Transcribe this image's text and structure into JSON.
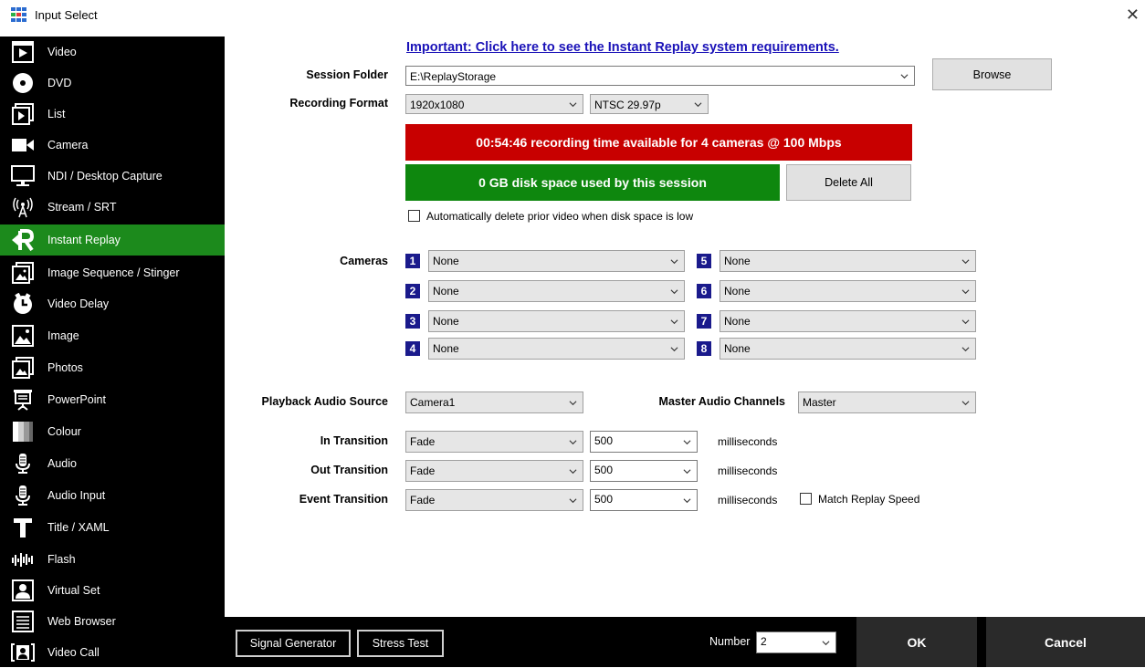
{
  "window": {
    "title": "Input Select"
  },
  "sidebar": {
    "items": [
      {
        "label": "Video",
        "icon": "video-icon"
      },
      {
        "label": "DVD",
        "icon": "dvd-icon"
      },
      {
        "label": "List",
        "icon": "list-icon"
      },
      {
        "label": "Camera",
        "icon": "camera-icon"
      },
      {
        "label": "NDI / Desktop Capture",
        "icon": "monitor-icon"
      },
      {
        "label": "Stream / SRT",
        "icon": "antenna-icon"
      },
      {
        "label": "Instant Replay",
        "icon": "replay-icon"
      },
      {
        "label": "Image Sequence / Stinger",
        "icon": "image-sequence-icon"
      },
      {
        "label": "Video Delay",
        "icon": "timer-icon"
      },
      {
        "label": "Image",
        "icon": "image-icon"
      },
      {
        "label": "Photos",
        "icon": "photos-icon"
      },
      {
        "label": "PowerPoint",
        "icon": "presentation-icon"
      },
      {
        "label": "Colour",
        "icon": "colour-icon"
      },
      {
        "label": "Audio",
        "icon": "microphone-icon"
      },
      {
        "label": "Audio Input",
        "icon": "microphone-icon"
      },
      {
        "label": "Title / XAML",
        "icon": "title-icon"
      },
      {
        "label": "Flash",
        "icon": "flash-icon"
      },
      {
        "label": "Virtual Set",
        "icon": "virtual-set-icon"
      },
      {
        "label": "Web Browser",
        "icon": "web-browser-icon"
      },
      {
        "label": "Video Call",
        "icon": "video-call-icon"
      }
    ]
  },
  "main": {
    "requirements_link": "Important: Click here to see the Instant Replay system requirements.",
    "session_folder": {
      "label": "Session Folder",
      "value": "E:\\ReplayStorage"
    },
    "browse_label": "Browse",
    "recording_format": {
      "label": "Recording Format",
      "resolution": "1920x1080",
      "framerate": "NTSC 29.97p"
    },
    "recording_banner": "00:54:46 recording time available for 4 cameras @ 100 Mbps",
    "disk_banner": "0 GB disk space used by this session",
    "delete_all_label": "Delete All",
    "auto_delete_label": "Automatically delete prior video when disk space is low",
    "cameras_label": "Cameras",
    "cameras": [
      {
        "num": "1",
        "value": "None"
      },
      {
        "num": "2",
        "value": "None"
      },
      {
        "num": "3",
        "value": "None"
      },
      {
        "num": "4",
        "value": "None"
      },
      {
        "num": "5",
        "value": "None"
      },
      {
        "num": "6",
        "value": "None"
      },
      {
        "num": "7",
        "value": "None"
      },
      {
        "num": "8",
        "value": "None"
      }
    ],
    "playback_audio": {
      "label": "Playback Audio Source",
      "value": "Camera1"
    },
    "master_audio": {
      "label": "Master Audio Channels",
      "value": "Master"
    },
    "in_transition": {
      "label": "In Transition",
      "effect": "Fade",
      "duration": "500",
      "unit": "milliseconds"
    },
    "out_transition": {
      "label": "Out Transition",
      "effect": "Fade",
      "duration": "500",
      "unit": "milliseconds"
    },
    "event_transition": {
      "label": "Event Transition",
      "effect": "Fade",
      "duration": "500",
      "unit": "milliseconds"
    },
    "match_replay_label": "Match Replay Speed"
  },
  "footer": {
    "signal_generator": "Signal Generator",
    "stress_test": "Stress Test",
    "number_label": "Number",
    "number_value": "2",
    "ok": "OK",
    "cancel": "Cancel"
  },
  "colors": {
    "active": "#1c8a1c",
    "red_banner": "#c80000",
    "green_banner": "#0e870e",
    "link": "#1a12b8",
    "camera_badge": "#1a1a8c"
  }
}
